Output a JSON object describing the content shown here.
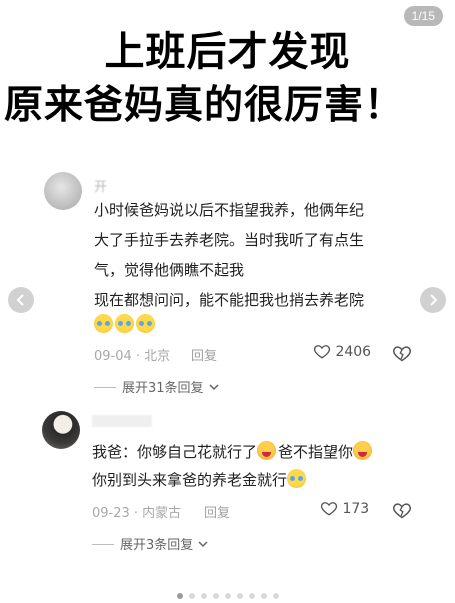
{
  "page_counter": "1/15",
  "headline": {
    "line1": "上班后才发现",
    "line2": "原来爸妈真的很厉害！"
  },
  "comments": [
    {
      "username": "开",
      "lines": [
        "小时候爸妈说以后不指望我养，他俩年纪",
        "大了手拉手去养老院。当时我听了有点生",
        "气，觉得他俩瞧不起我",
        "现在都想问问，能不能把我也捎去养老院"
      ],
      "emojis": [
        "crying-laughing-emoji",
        "crying-laughing-emoji",
        "crying-laughing-emoji"
      ],
      "meta": "09-04 · 北京",
      "reply_label": "回复",
      "likes": "2406",
      "expand": "展开31条回复"
    },
    {
      "username": "",
      "line1_a": "我爸：你够自己花就行了",
      "line1_b": "爸不指望你",
      "line2": "你别到头来拿爸的养老金就行",
      "meta": "09-23 · 内蒙古",
      "reply_label": "回复",
      "likes": "173",
      "expand": "展开3条回复"
    }
  ],
  "icons": {
    "prev": "chevron-left-icon",
    "next": "chevron-right-icon",
    "like": "heart-icon",
    "dislike": "broken-heart-icon",
    "expand": "chevron-down-icon"
  },
  "pagination": {
    "total": 15,
    "current": 1
  }
}
